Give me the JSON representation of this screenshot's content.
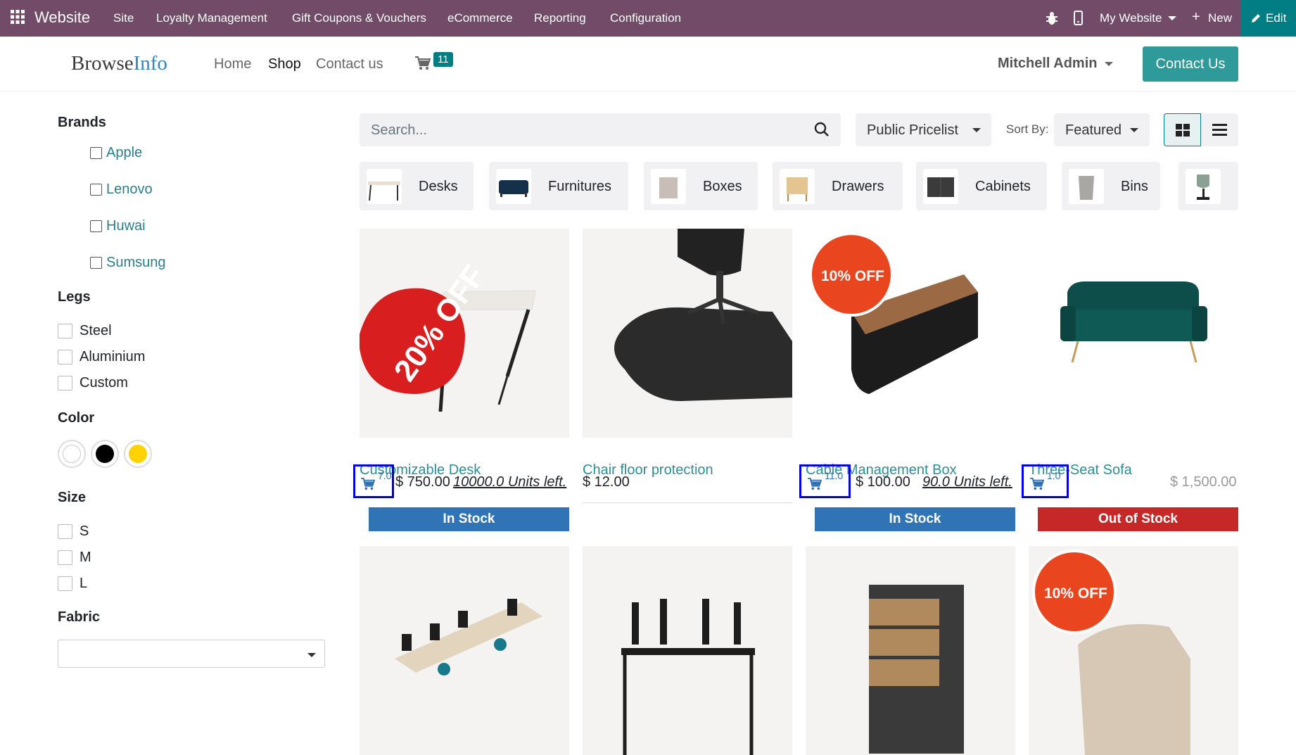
{
  "topbar": {
    "app_name": "Website",
    "menu": [
      "Site",
      "Loyalty Management",
      "Gift Coupons & Vouchers",
      "eCommerce",
      "Reporting",
      "Configuration"
    ],
    "website_selector": "My Website",
    "new_label": "New",
    "edit_label": "Edit",
    "bg_color": "#714b67"
  },
  "header": {
    "logo_a": "Browse",
    "logo_b": "Info",
    "nav": [
      "Home",
      "Shop",
      "Contact us"
    ],
    "active_nav": "Shop",
    "cart_count": "11",
    "user": "Mitchell Admin",
    "contact_button": "Contact Us"
  },
  "filters": {
    "brands": {
      "title": "Brands",
      "items": [
        "Apple",
        "Lenovo",
        "Huwai",
        "Sumsung"
      ]
    },
    "legs": {
      "title": "Legs",
      "items": [
        "Steel",
        "Aluminium",
        "Custom"
      ]
    },
    "color": {
      "title": "Color",
      "swatches": [
        "#ffffff",
        "#000000",
        "#ffd200"
      ]
    },
    "size": {
      "title": "Size",
      "items": [
        "S",
        "M",
        "L"
      ]
    },
    "fabric": {
      "title": "Fabric"
    }
  },
  "toolbar": {
    "search_placeholder": "Search...",
    "pricelist": "Public Pricelist",
    "sort_label": "Sort By:",
    "sort_value": "Featured"
  },
  "categories": [
    "Desks",
    "Furnitures",
    "Boxes",
    "Drawers",
    "Cabinets",
    "Bins"
  ],
  "products": [
    {
      "name": "Customizable Desk",
      "price": "$ 750.00",
      "qty": "7.0",
      "units": "10000.0 Units left.",
      "stock": "In Stock",
      "badge": "20% OFF"
    },
    {
      "name": "Chair floor protection",
      "price": "$ 12.00"
    },
    {
      "name": "Cable Management Box",
      "price": "$ 100.00",
      "qty": "11.0",
      "units": "90.0 Units left.",
      "stock": "In Stock",
      "badge": "10% OFF"
    },
    {
      "name": "Three-Seat Sofa",
      "price": "$ 1,500.00",
      "qty": "1.0",
      "stock": "Out of Stock"
    },
    {
      "name": "",
      "price": ""
    },
    {
      "name": "",
      "price": ""
    },
    {
      "name": "",
      "price": ""
    },
    {
      "name": "",
      "price": "",
      "badge": "10% OFF"
    }
  ],
  "colors": {
    "in_stock": "#3174b6",
    "out_of_stock": "#c62828",
    "teal": "#017e84",
    "link": "#2a8f96"
  }
}
